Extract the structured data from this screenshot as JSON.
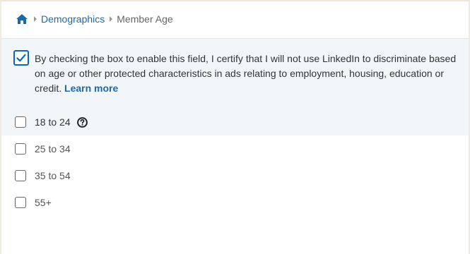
{
  "breadcrumb": {
    "home_icon": "home-icon",
    "items": [
      "Demographics",
      "Member Age"
    ]
  },
  "certification": {
    "checked": true,
    "text": "By checking the box to enable this field, I certify that I will not use LinkedIn to discriminate based on age or other protected characteristics in ads relating to employment, housing, education or credit.",
    "link_label": "Learn more"
  },
  "age_options": [
    {
      "label": "18 to 24",
      "checked": false,
      "help_icon": "question-circle-icon"
    },
    {
      "label": "25 to 34",
      "checked": false
    },
    {
      "label": "35 to 54",
      "checked": false
    },
    {
      "label": "55+",
      "checked": false
    }
  ],
  "colors": {
    "accent": "#0a66c2",
    "link": "#1a6aa8",
    "panel_background": "#f3f6f8"
  }
}
